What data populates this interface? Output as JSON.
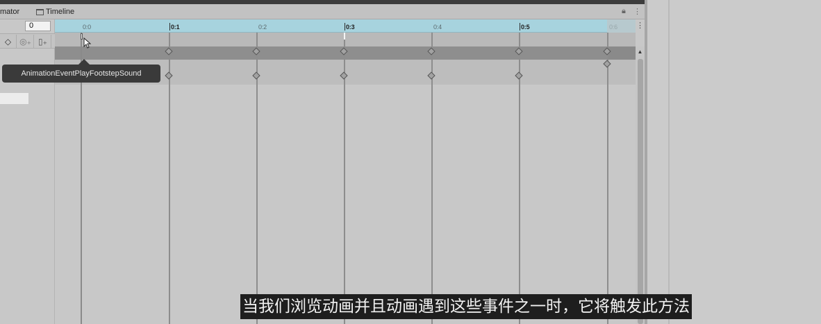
{
  "tabs": {
    "animator": "mator",
    "timeline": "Timeline"
  },
  "toolbar": {
    "frame_value": "0",
    "add_keyframe_icon": "add-keyframe-icon",
    "add_property_icon": "add-property-icon",
    "add_event_icon": "add-event-icon"
  },
  "ruler": {
    "ticks": [
      {
        "label": "0:0",
        "style": "minor"
      },
      {
        "label": "0:1",
        "style": "major"
      },
      {
        "label": "0:2",
        "style": "minor"
      },
      {
        "label": "0:3",
        "style": "major"
      },
      {
        "label": "0:4",
        "style": "minor"
      },
      {
        "label": "0:5",
        "style": "major"
      },
      {
        "label": "0:6",
        "style": "faded"
      }
    ]
  },
  "tooltip": {
    "text": "AnimationEventPlayFootstepSound"
  },
  "subtitle": {
    "text": "当我们浏览动画并且动画遇到这些事件之一时，它将触发此方法"
  },
  "icons": {
    "lock": "lock-icon",
    "menu": "menu-dots-icon",
    "cursor": "mouse-cursor-icon"
  },
  "colors": {
    "ruler_bg": "#a7d3de",
    "tooltip_bg": "#3a3a3a",
    "subtitle_bg": "#1e1e1e"
  }
}
